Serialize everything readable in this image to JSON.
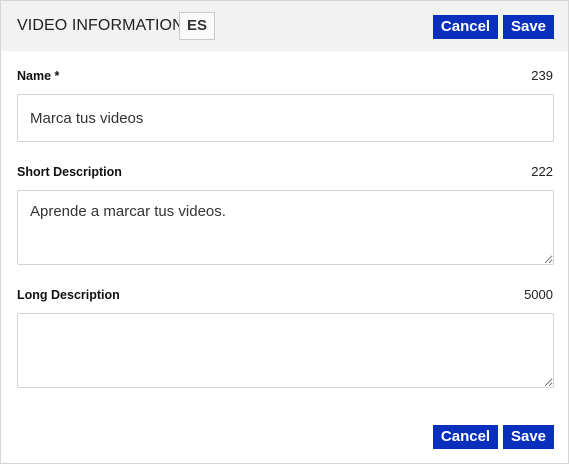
{
  "header": {
    "title": "VIDEO INFORMATION",
    "language_badge": "ES",
    "cancel_label": "Cancel",
    "save_label": "Save"
  },
  "fields": {
    "name": {
      "label": "Name *",
      "count": "239",
      "value": "Marca tus videos"
    },
    "short_description": {
      "label": "Short Description",
      "count": "222",
      "value": "Aprende a marcar tus videos."
    },
    "long_description": {
      "label": "Long Description",
      "count": "5000",
      "value": ""
    }
  },
  "footer": {
    "cancel_label": "Cancel",
    "save_label": "Save"
  },
  "colors": {
    "header_bg": "#f2f2f2",
    "button_bg": "#0b2fbd",
    "button_text": "#ffffff",
    "border": "#d3d3d3"
  }
}
